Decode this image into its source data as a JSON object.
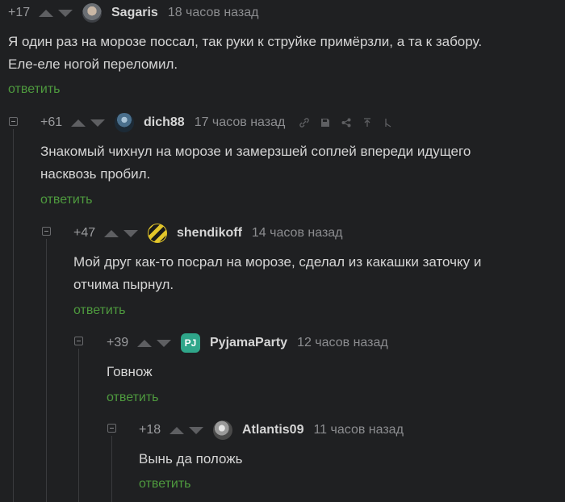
{
  "comments": [
    {
      "rating": "+17",
      "author": "Sagaris",
      "time": "18 часов назад",
      "text_lines": [
        "Я один раз на морозе поссал, так руки к струйке примёрзли, а та к забору.",
        "Еле-еле ногой переломил."
      ],
      "reply": "ответить",
      "avatar_icon": "photo-avatar-icon"
    },
    {
      "rating": "+61",
      "author": "dich88",
      "time": "17 часов назад",
      "text_lines": [
        "Знакомый чихнул на морозе и замерзшей соплей впереди идущего",
        "насквозь пробил."
      ],
      "reply": "ответить",
      "avatar_icon": "robot-avatar-icon"
    },
    {
      "rating": "+47",
      "author": "shendikoff",
      "time": "14 часов назад",
      "text_lines": [
        "Мой друг как-то посрал на морозе, сделал из какашки заточку и",
        "отчима пырнул."
      ],
      "reply": "ответить",
      "avatar_icon": "striped-avatar-icon"
    },
    {
      "rating": "+39",
      "author": "PyjamaParty",
      "time": "12 часов назад",
      "text_lines": [
        "Говнож"
      ],
      "reply": "ответить",
      "avatar_icon": "pj-logo-avatar",
      "avatar_text": "PJ"
    },
    {
      "rating": "+18",
      "author": "Atlantis09",
      "time": "11 часов назад",
      "text_lines": [
        "Вынь да положь"
      ],
      "reply": "ответить",
      "avatar_icon": "bw-photo-avatar-icon"
    }
  ],
  "colors": {
    "background": "#1f2022",
    "text": "#d5d5d5",
    "muted": "#8c8d90",
    "reply_link": "#4e9a3e",
    "pj_avatar": "#2fa68a"
  },
  "toolbar_icons": [
    "link-icon",
    "save-icon",
    "share-icon",
    "scroll-up-icon",
    "branch-icon"
  ]
}
